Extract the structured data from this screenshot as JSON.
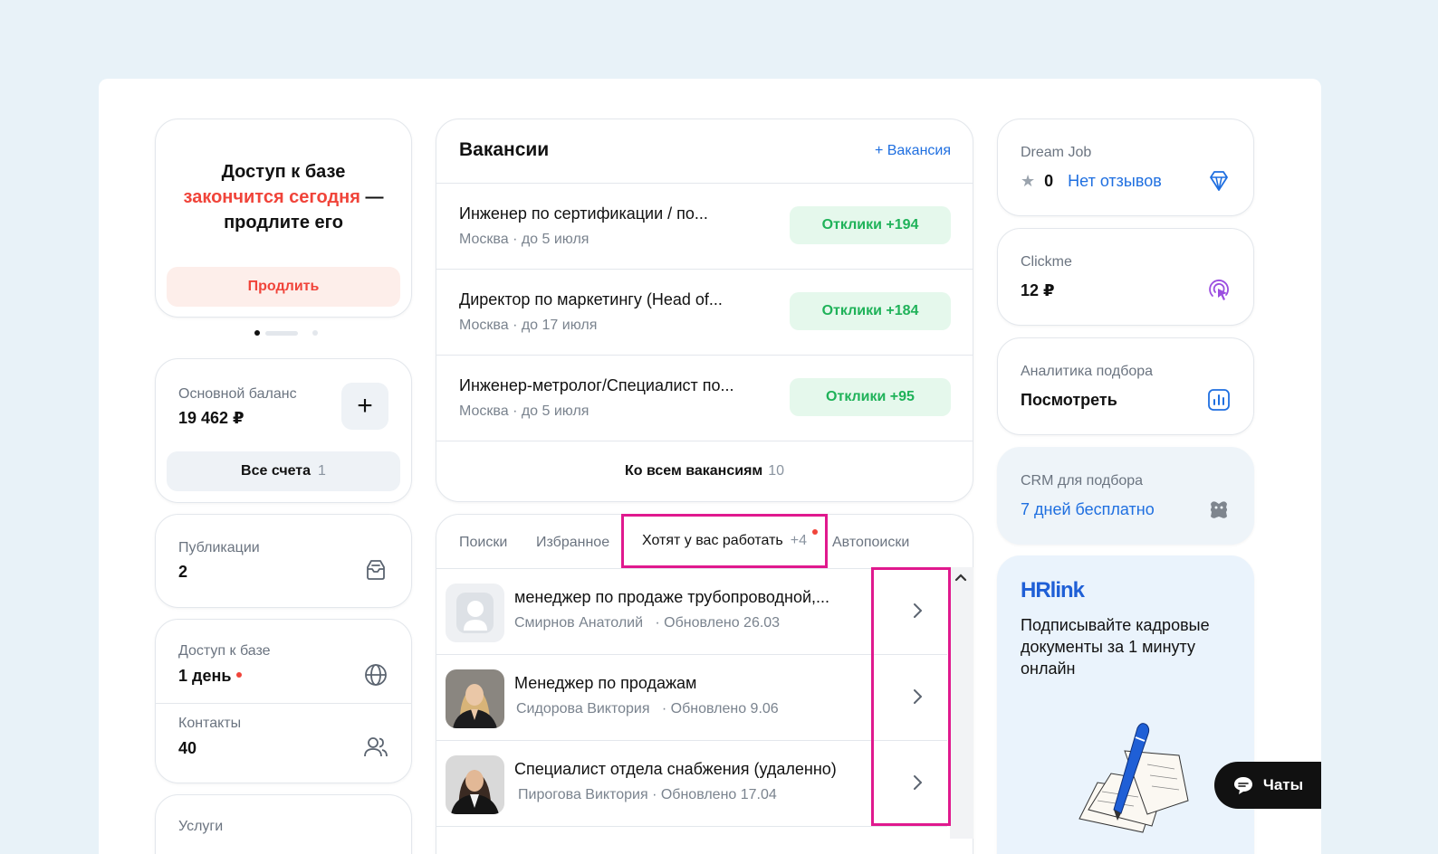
{
  "promo": {
    "line1": "Доступ к базе",
    "line2_red": "закончится сегодня",
    "line2_rest": " —",
    "line3": "продлите его",
    "button": "Продлить"
  },
  "balance": {
    "label": "Основной баланс",
    "value": "19 462 ₽",
    "add_icon": "+",
    "all_accounts": "Все счета",
    "all_accounts_count": "1"
  },
  "publications": {
    "label": "Публикации",
    "value": "2",
    "icon": "inbox-icon"
  },
  "db_access": {
    "label": "Доступ к базе",
    "value": "1 день",
    "icon": "globe-icon"
  },
  "contacts": {
    "label": "Контакты",
    "value": "40",
    "icon": "users-icon"
  },
  "services": {
    "label": "Услуги"
  },
  "vacancies": {
    "title": "Вакансии",
    "add_label": "+ Вакансия",
    "items": [
      {
        "name": "Инженер по сертификации / по...",
        "meta": "Москва · до 5 июля",
        "responses": "Отклики  +194"
      },
      {
        "name": "Директор по маркетингу (Head of...",
        "meta": "Москва · до 17 июля",
        "responses": "Отклики  +184"
      },
      {
        "name": "Инженер-метролог/Специалист по...",
        "meta": "Москва · до 5 июля",
        "responses": "Отклики  +95"
      }
    ],
    "all_label": "Ко всем вакансиям",
    "all_count": "10"
  },
  "candidates": {
    "tabs": [
      "Поиски",
      "Избранное",
      "Хотят у вас работать",
      "Автопоиски"
    ],
    "active_tab_count": "+4",
    "items": [
      {
        "title": "менеджер по продаже трубопроводной,...",
        "name": "Смирнов Анатолий",
        "updated": "· Обновлено 26.03"
      },
      {
        "title": "Менеджер по продажам",
        "name": "Сидорова Виктория",
        "updated": "· Обновлено 9.06"
      },
      {
        "title": "Специалист отдела снабжения (удаленно)",
        "name": "Пирогова Виктория",
        "updated": "· Обновлено 17.04"
      }
    ]
  },
  "right": {
    "dream_job": {
      "label": "Dream Job",
      "rating": "0",
      "reviews": "Нет отзывов"
    },
    "clickme": {
      "label": "Clickme",
      "value": "12 ₽"
    },
    "analytics": {
      "label": "Аналитика подбора",
      "value": "Посмотреть"
    },
    "crm": {
      "label": "CRM для подбора",
      "value": "7 дней бесплатно"
    },
    "hrlink": {
      "logo": "HRlink",
      "text": "Подписывайте кадровые документы за 1 минуту онлайн"
    }
  },
  "chat": {
    "label": "Чаты"
  },
  "colors": {
    "accent": "#1f6fe0",
    "danger": "#f0443a",
    "success": "#1fb259",
    "highlight": "#e0198e"
  }
}
